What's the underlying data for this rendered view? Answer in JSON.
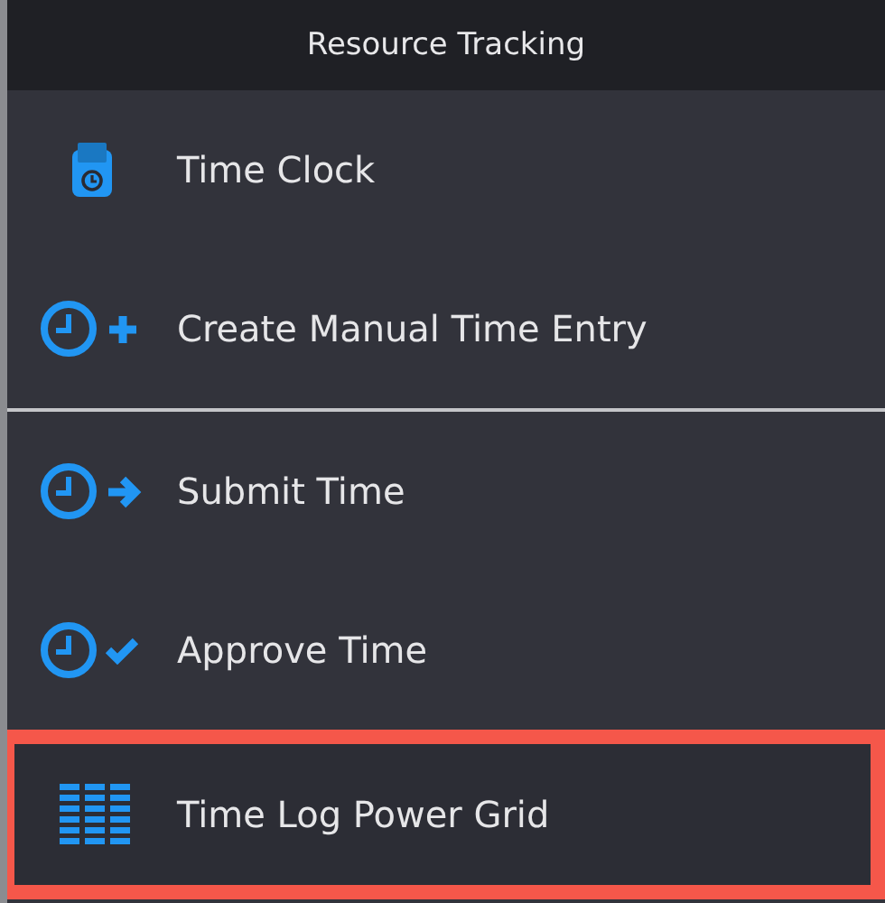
{
  "menu": {
    "title": "Resource Tracking",
    "groups": [
      [
        {
          "label": "Time Clock",
          "kind": "clock-card",
          "highlighted": false
        },
        {
          "label": "Create Manual Time Entry",
          "kind": "clock-plus",
          "highlighted": false
        }
      ],
      [
        {
          "label": "Submit Time",
          "kind": "clock-arrow",
          "highlighted": false
        },
        {
          "label": "Approve Time",
          "kind": "clock-check",
          "highlighted": false
        },
        {
          "label": "Time Log Power Grid",
          "kind": "grid",
          "highlighted": true
        }
      ]
    ]
  }
}
